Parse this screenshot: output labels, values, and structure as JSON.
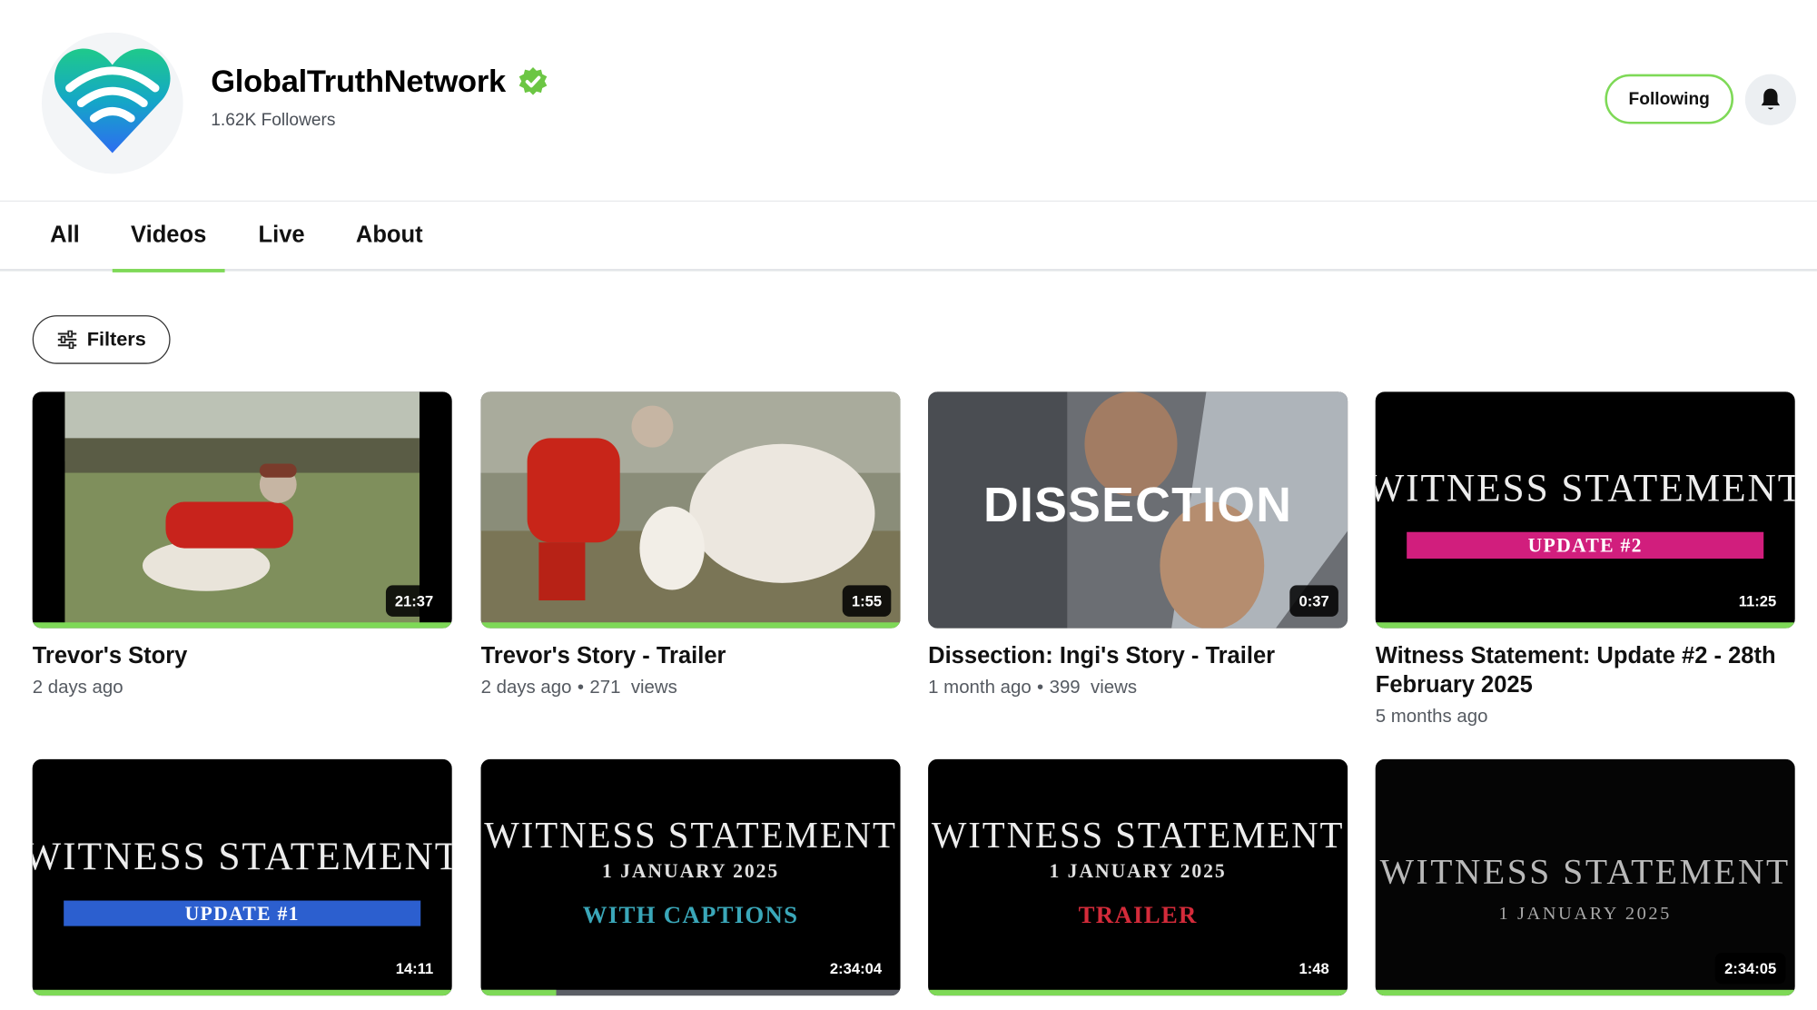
{
  "channel": {
    "name": "GlobalTruthNetwork",
    "followers": "1.62K Followers",
    "following_label": "Following",
    "brand_color": "#7ed957",
    "verified_color": "#6cc644"
  },
  "tabs": [
    {
      "label": "All"
    },
    {
      "label": "Videos"
    },
    {
      "label": "Live"
    },
    {
      "label": "About"
    }
  ],
  "active_tab": "Videos",
  "filters_label": "Filters",
  "videos": [
    {
      "title": "Trevor's Story",
      "duration": "21:37",
      "age": "2 days ago",
      "views": "",
      "watched": 1.0
    },
    {
      "title": "Trevor's Story - Trailer",
      "duration": "1:55",
      "age": "2 days ago",
      "views": "271",
      "views_suffix": "views",
      "watched": 1.0
    },
    {
      "title": "Dissection: Ingi's Story - Trailer",
      "duration": "0:37",
      "age": "1 month ago",
      "views": "399",
      "views_suffix": "views",
      "watched": 0.0,
      "thumb_text": "DISSECTION"
    },
    {
      "title": "Witness Statement: Update #2 - 28th February 2025",
      "duration": "11:25",
      "age": "5 months ago",
      "views": "",
      "watched": 1.0,
      "thumb_text": "WITNESS STATEMENT",
      "thumb_sub": "UPDATE #2"
    },
    {
      "title": "",
      "duration": "14:11",
      "age": "",
      "views": "",
      "watched": 1.0,
      "thumb_text": "WITNESS STATEMENT",
      "thumb_sub": "UPDATE #1"
    },
    {
      "title": "",
      "duration": "2:34:04",
      "age": "",
      "views": "",
      "watched": 0.18,
      "thumb_text": "WITNESS STATEMENT",
      "thumb_date": "1 JANUARY 2025",
      "thumb_sub": "WITH CAPTIONS"
    },
    {
      "title": "",
      "duration": "1:48",
      "age": "",
      "views": "",
      "watched": 1.0,
      "thumb_text": "WITNESS STATEMENT",
      "thumb_date": "1 JANUARY 2025",
      "thumb_sub": "TRAILER"
    },
    {
      "title": "",
      "duration": "2:34:05",
      "age": "",
      "views": "",
      "watched": 1.0,
      "thumb_text": "WITNESS STATEMENT",
      "thumb_date": "1 JANUARY 2025"
    }
  ]
}
